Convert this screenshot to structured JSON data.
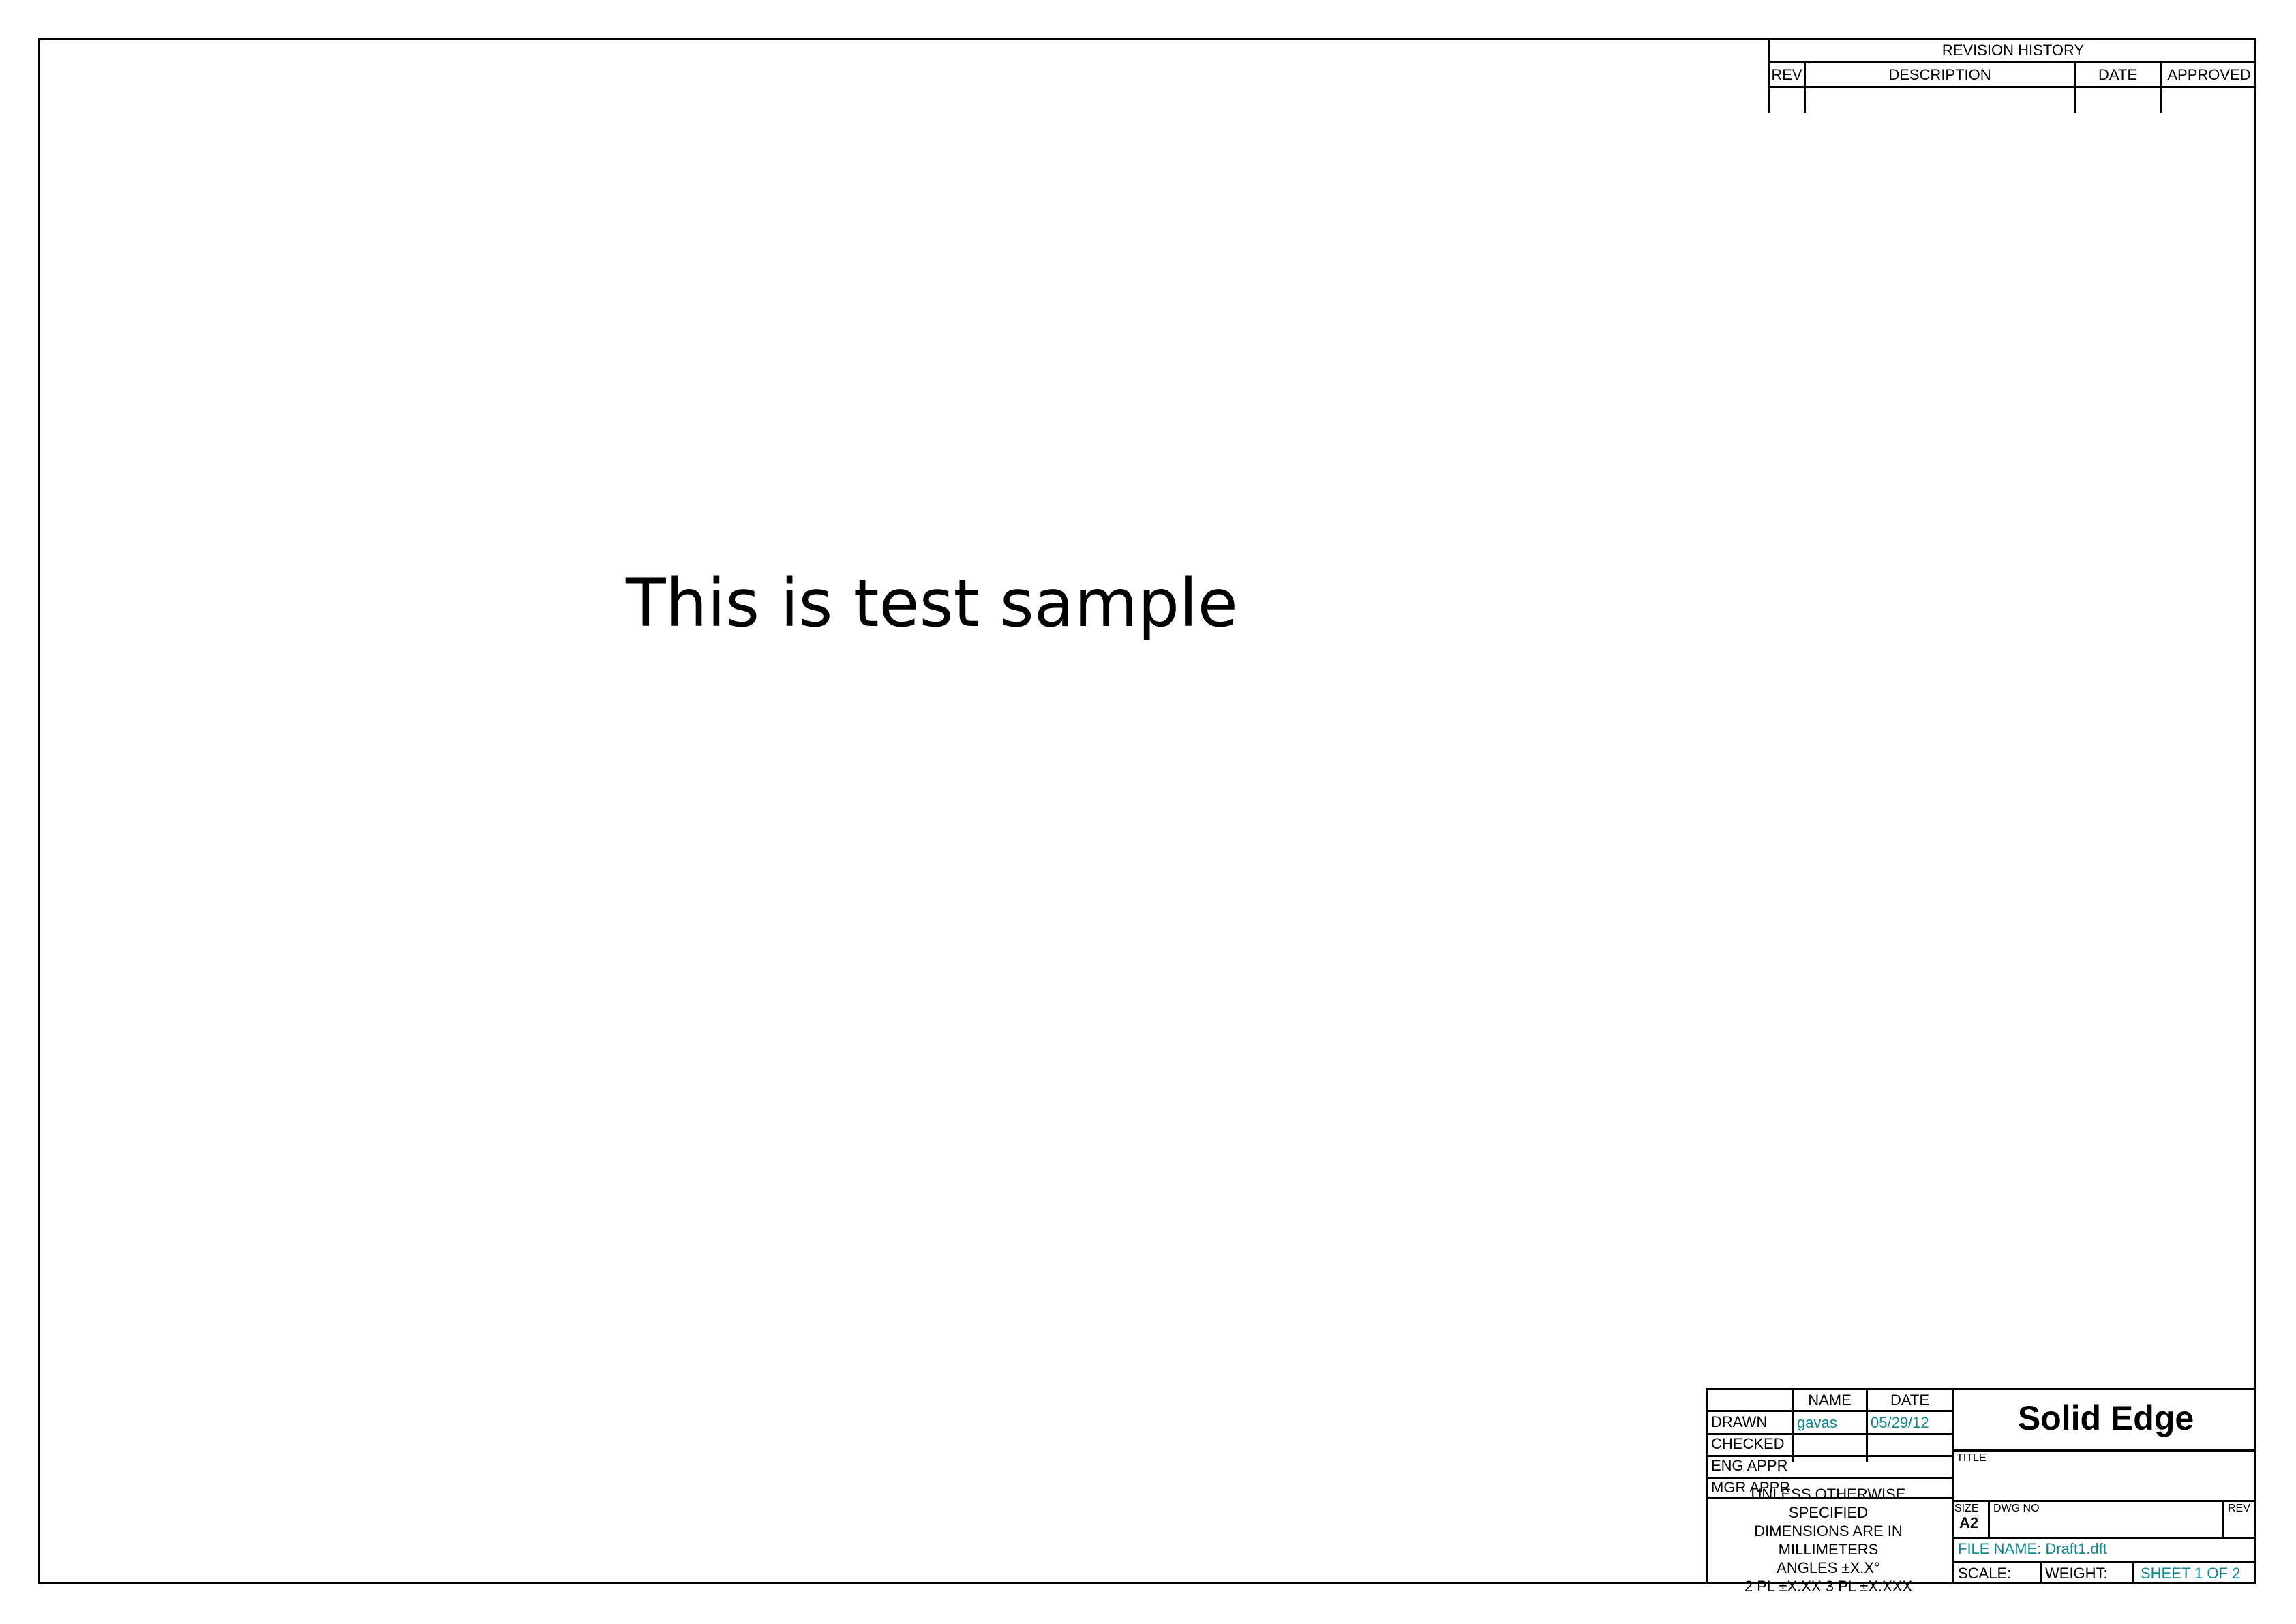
{
  "revision_history": {
    "title": "REVISION HISTORY",
    "columns": [
      "REV",
      "DESCRIPTION",
      "DATE",
      "APPROVED"
    ]
  },
  "main_text": "This is test sample",
  "title_block": {
    "headers": {
      "name": "NAME",
      "date": "DATE"
    },
    "rows": [
      {
        "label": "DRAWN",
        "name": "gavas",
        "date": "05/29/12"
      },
      {
        "label": "CHECKED",
        "name": "",
        "date": ""
      },
      {
        "label": "ENG APPR",
        "name": "",
        "date": ""
      },
      {
        "label": "MGR APPR",
        "name": "",
        "date": ""
      }
    ],
    "notes": [
      "UNLESS OTHERWISE",
      "SPECIFIED",
      "DIMENSIONS ARE IN",
      "MILLIMETERS",
      "ANGLES ±X.X°",
      "2 PL ±X.XX 3 PL ±X.XXX"
    ],
    "brand": "Solid Edge",
    "title_label": "TITLE",
    "size_label": "SIZE",
    "size_value": "A2",
    "dwg_no_label": "DWG NO",
    "rev_label": "REV",
    "file_name": "FILE NAME: Draft1.dft",
    "scale_label": "SCALE:",
    "weight_label": "WEIGHT:",
    "sheet": "SHEET 1 OF 2"
  },
  "colors": {
    "line": "#000000",
    "field_value": "#0a8a8f"
  }
}
